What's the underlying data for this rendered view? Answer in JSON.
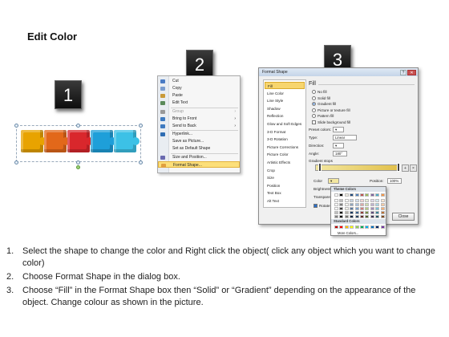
{
  "title": "Edit Color",
  "steps": [
    "1",
    "2",
    "3"
  ],
  "puzzle_colors": [
    "#e8a300",
    "#e2681a",
    "#d9272c",
    "#1e9fd9",
    "#3cc1e6"
  ],
  "context_menu": {
    "items": [
      {
        "label": "Cut",
        "icon": "scissors-icon",
        "disabled": false
      },
      {
        "label": "Copy",
        "icon": "copy-icon",
        "disabled": false
      },
      {
        "label": "Paste",
        "icon": "paste-icon",
        "disabled": false
      },
      {
        "label": "Edit Text",
        "icon": "text-icon",
        "disabled": false
      },
      {
        "label": "Group",
        "icon": "group-icon",
        "disabled": true,
        "submenu": true
      },
      {
        "label": "Bring to Front",
        "icon": "bring-front-icon",
        "disabled": false,
        "submenu": true
      },
      {
        "label": "Send to Back",
        "icon": "send-back-icon",
        "disabled": false,
        "submenu": true
      },
      {
        "label": "Hyperlink...",
        "icon": "link-icon",
        "disabled": false
      },
      {
        "label": "Save as Picture...",
        "icon": "",
        "disabled": false
      },
      {
        "label": "Set as Default Shape",
        "icon": "",
        "disabled": false
      },
      {
        "label": "Size and Position...",
        "icon": "size-icon",
        "disabled": false
      },
      {
        "label": "Format Shape...",
        "icon": "format-icon",
        "disabled": false,
        "highlighted": true
      }
    ]
  },
  "dialog": {
    "title": "Format Shape",
    "nav": [
      "Fill",
      "Line Color",
      "Line Style",
      "Shadow",
      "Reflection",
      "Glow and Soft Edges",
      "3-D Format",
      "3-D Rotation",
      "Picture Corrections",
      "Picture Color",
      "Artistic Effects",
      "Crop",
      "Size",
      "Position",
      "Text Box",
      "Alt Text"
    ],
    "section": "Fill",
    "options": [
      "No fill",
      "Solid fill",
      "Gradient fill",
      "Picture or texture fill",
      "Pattern fill",
      "Slide background fill"
    ],
    "preset_label": "Preset colors:",
    "type_label": "Type:",
    "type_value": "Linear",
    "direction_label": "Direction:",
    "angle_label": "Angle:",
    "angle_value": "180°",
    "stops_label": "Gradient stops",
    "color_label": "Color",
    "position_label": "Position:",
    "position_value": "100%",
    "brightness_label": "Brightness:",
    "transparency_label": "Transparency:",
    "rotate_label": "Rotate with shape",
    "close_label": "Close"
  },
  "color_picker": {
    "theme_header": "Theme Colors",
    "standard_header": "Standard Colors",
    "more": "More Colors...",
    "theme_top": [
      "#ffffff",
      "#000000",
      "#eeece1",
      "#1f497d",
      "#4f81bd",
      "#c0504d",
      "#9bbb59",
      "#8064a2",
      "#4bacc6",
      "#f79646"
    ],
    "standard": [
      "#c00000",
      "#ff0000",
      "#ffc000",
      "#ffff00",
      "#92d050",
      "#00b050",
      "#00b0f0",
      "#0070c0",
      "#002060",
      "#7030a0"
    ]
  },
  "instructions": [
    {
      "num": "1.",
      "text": "Select the shape to change the color and Right click the object( click any object which you want to change color)"
    },
    {
      "num": "2.",
      "text": "Choose Format Shape in the dialog box."
    },
    {
      "num": "3.",
      "text": "Choose “Fill” in the Format Shape box then “Solid” or “Gradient” depending on the appearance of the object. Change colour as shown in the picture."
    }
  ]
}
